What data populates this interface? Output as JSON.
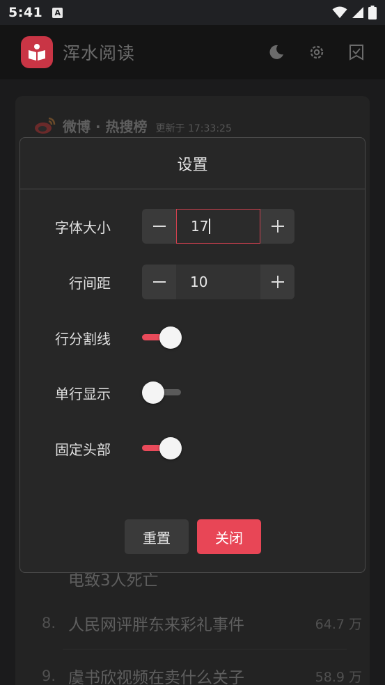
{
  "status_bar": {
    "time": "5:41",
    "notification_glyph": "A"
  },
  "app_bar": {
    "title": "浑水阅读",
    "icons": [
      "moon-icon",
      "gear-icon",
      "checklist-icon"
    ]
  },
  "card": {
    "source": "微博 · 热搜榜",
    "updated": "更新于 17:33:25",
    "partial_item": "电致3人死亡",
    "items": [
      {
        "rank": "8.",
        "title": "人民网评胖东来彩礼事件",
        "count": "64.7 万"
      },
      {
        "rank": "9.",
        "title": "虞书欣视频在卖什么关子",
        "count": "58.9 万"
      }
    ]
  },
  "dialog": {
    "title": "设置",
    "font_size": {
      "label": "字体大小",
      "value": "17"
    },
    "line_spacing": {
      "label": "行间距",
      "value": "10"
    },
    "line_divider": {
      "label": "行分割线",
      "on": true
    },
    "single_line": {
      "label": "单行显示",
      "on": false
    },
    "fixed_header": {
      "label": "固定头部",
      "on": true
    },
    "reset_label": "重置",
    "close_label": "关闭"
  },
  "colors": {
    "accent": "#e84656",
    "dialog_bg": "#272727",
    "app_bg": "#1b1b1c"
  }
}
